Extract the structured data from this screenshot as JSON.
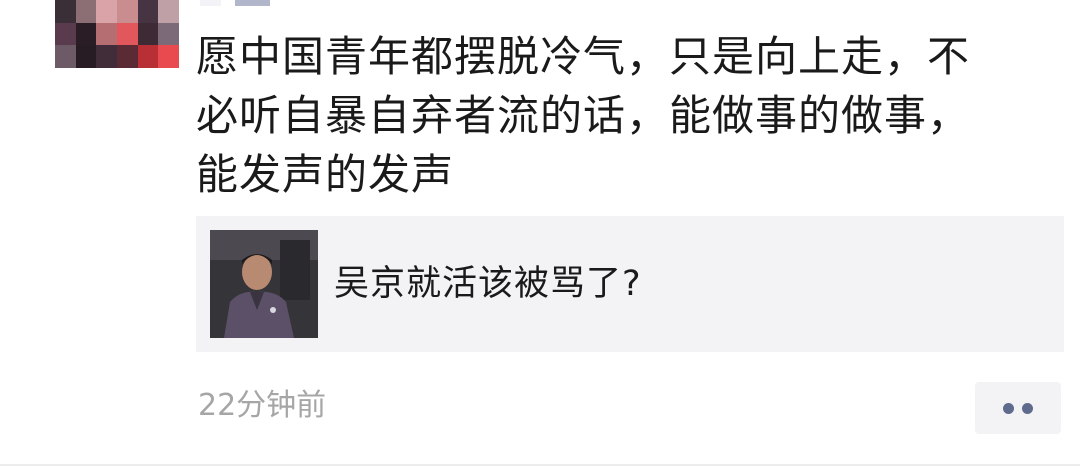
{
  "post": {
    "avatar_alt": "avatar",
    "text": "愿中国青年都摆脱冷气，只是向上走，不\n必听自暴自弃者流的话，能做事的做事，\n能发声的发声",
    "link_card": {
      "title": "吴京就活该被骂了?"
    },
    "timestamp": "22分钟前"
  },
  "colors": {
    "text": "#1a1a1a",
    "muted": "#a6a6a6",
    "card_bg": "#f3f3f5",
    "link_blue": "#5e6b8c"
  },
  "icons": {
    "more": "more-dots-icon"
  }
}
